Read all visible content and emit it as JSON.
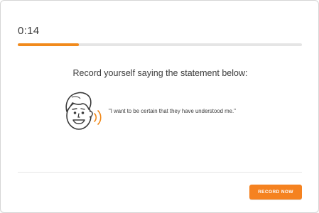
{
  "timer": {
    "elapsed": "0:14"
  },
  "progress": {
    "fraction": 0.215
  },
  "prompt": {
    "instruction": "Record yourself saying the statement below:",
    "statement": "\"I want to be certain that they have understood me.\"",
    "illustration_icon": "speaking-face-icon"
  },
  "actions": {
    "record_label": "RECORD NOW"
  },
  "colors": {
    "accent": "#f18a1c",
    "button": "#f58220",
    "track": "#e5e5e5",
    "text": "#3c3c3c"
  }
}
